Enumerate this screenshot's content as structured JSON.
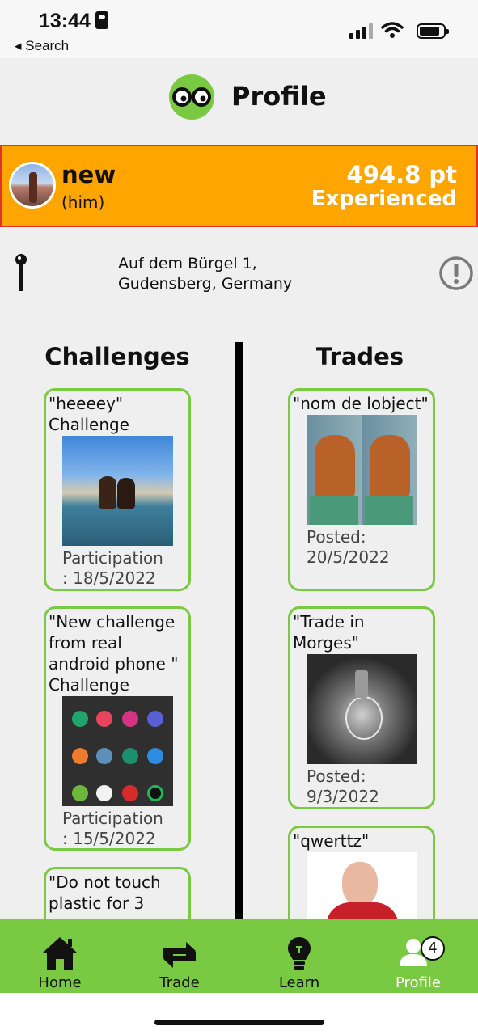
{
  "status_bar": {
    "time": "13:44",
    "back_label": "◂ Search"
  },
  "header": {
    "title": "Profile"
  },
  "user": {
    "name": "new",
    "pronoun": "(him)",
    "points": "494.8 pt",
    "level": "Experienced"
  },
  "location": {
    "line1": "Auf dem Bürgel 1,",
    "line2": "Gudensberg, Germany"
  },
  "columns": {
    "challenges_heading": "Challenges",
    "trades_heading": "Trades"
  },
  "challenges": [
    {
      "title": "\"heeeey\" Challenge",
      "meta_1": "Participation",
      "meta_2": ": 18/5/2022"
    },
    {
      "title": "\"New challenge from real android phone \" Challenge",
      "meta_1": "Participation",
      "meta_2": ": 15/5/2022"
    },
    {
      "title": "\"Do not touch plastic for 3"
    }
  ],
  "trades": [
    {
      "title": "\"nom de lobject\"",
      "meta_1": "Posted:",
      "meta_2": "20/5/2022"
    },
    {
      "title": "\"Trade in Morges\"",
      "meta_1": "Posted:",
      "meta_2": "9/3/2022"
    },
    {
      "title": "\"qwerttz\""
    }
  ],
  "tabbar": {
    "tabs": [
      {
        "label": "Home"
      },
      {
        "label": "Trade"
      },
      {
        "label": "Learn"
      },
      {
        "label": "Profile"
      }
    ],
    "profile_badge": "4",
    "active_color": "#ffffff",
    "bar_color": "#7ac943"
  },
  "colors": {
    "user_card": "#ffa500",
    "card_border": "#7ac943",
    "user_card_border": "#e53030"
  }
}
